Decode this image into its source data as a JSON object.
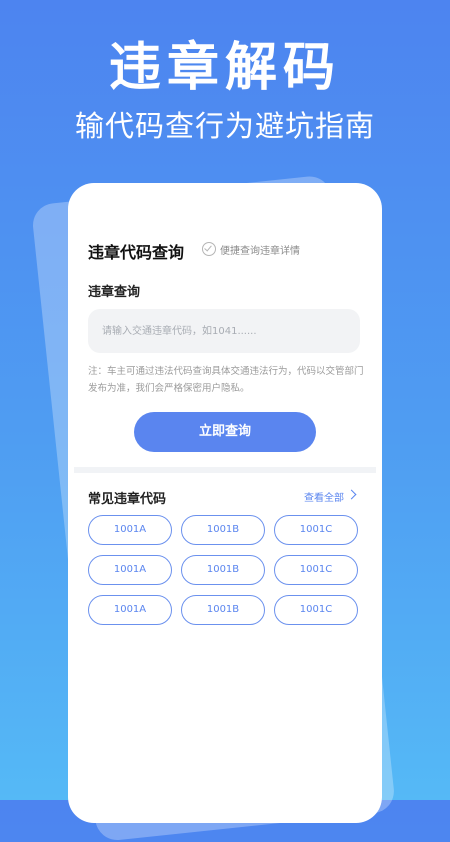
{
  "hero": {
    "title": "违章解码",
    "subtitle": "输代码查行为避坑指南"
  },
  "card": {
    "title": "违章代码查询",
    "hint": "便捷查询违章详情",
    "section_label": "违章查询",
    "input": {
      "placeholder": "请输入交通违章代码，如1041......",
      "value": ""
    },
    "note": "注：车主可通过违法代码查询具体交通违法行为，代码以交管部门发布为准，我们会严格保密用户隐私。",
    "query_button": "立即查询",
    "common_title": "常见违章代码",
    "view_all": "查看全部",
    "codes": [
      [
        "1001A",
        "1001B",
        "1001C"
      ],
      [
        "1001A",
        "1001B",
        "1001C"
      ],
      [
        "1001A",
        "1001B",
        "1001C"
      ]
    ]
  },
  "colors": {
    "accent": "#5a85ef",
    "background_top": "#4d84f0",
    "background_bottom": "#55b9f6"
  },
  "icons": {
    "check": "check-circle-icon",
    "chevron": "chevron-right-icon"
  }
}
